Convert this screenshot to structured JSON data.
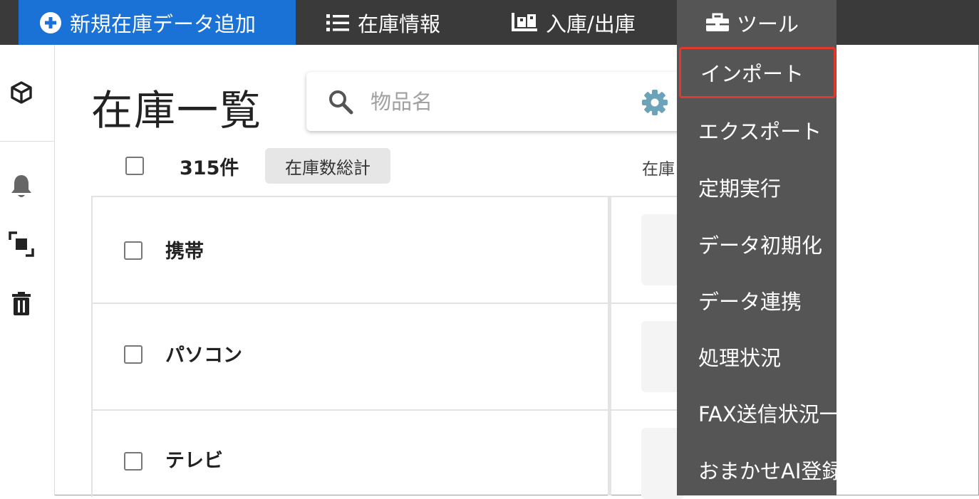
{
  "nav": {
    "add_label": "新規在庫データ追加",
    "inventory_label": "在庫情報",
    "inout_label": "入庫/出庫",
    "tools_label": "ツール"
  },
  "main": {
    "title": "在庫一覧",
    "search_placeholder": "物品名",
    "count": "315件",
    "total_button": "在庫数総計",
    "column_header_partial": "在庫"
  },
  "rows": [
    {
      "name": "携帯"
    },
    {
      "name": "パソコン"
    },
    {
      "name": "テレビ"
    }
  ],
  "tools_menu": {
    "items": [
      {
        "label": "インポート",
        "selected": true
      },
      {
        "label": "エクスポート"
      },
      {
        "label": "定期実行"
      },
      {
        "label": "データ初期化"
      },
      {
        "label": "データ連携"
      },
      {
        "label": "処理状況"
      },
      {
        "label": "FAX送信状況一覧"
      },
      {
        "label": "おまかせAI登録"
      }
    ]
  },
  "colors": {
    "nav_bg": "#3a3a3a",
    "add_button_bg": "#1a72d6",
    "menu_bg": "#555555",
    "selected_outline": "#e03a2e"
  }
}
